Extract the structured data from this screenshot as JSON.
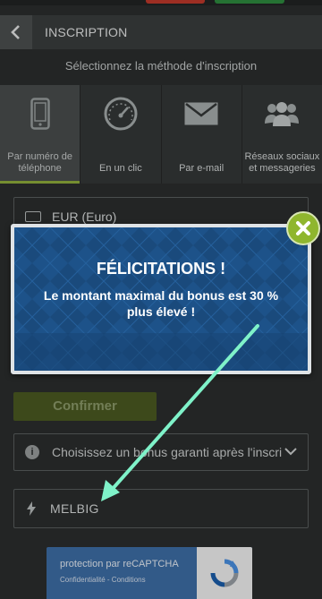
{
  "header": {
    "title": "INSCRIPTION",
    "back_icon": "chevron-left-icon"
  },
  "subtitle": "Sélectionnez la méthode d'inscription",
  "methods": [
    {
      "label": "Par numéro de téléphone",
      "icon": "phone-icon",
      "active": true
    },
    {
      "label": "En un clic",
      "icon": "speedometer-icon",
      "active": false
    },
    {
      "label": "Par e-mail",
      "icon": "envelope-icon",
      "active": false
    },
    {
      "label": "Réseaux sociaux et messageries",
      "icon": "users-icon",
      "active": false
    }
  ],
  "currency": {
    "value": "EUR (Euro)",
    "icon": "banknote-icon"
  },
  "confirm_label": "Confirmer",
  "bonus": {
    "placeholder": "Choisissez un bonus garanti après l'inscription",
    "icon": "info-icon"
  },
  "promo": {
    "value": "MELBIG",
    "icon": "lightning-icon"
  },
  "recaptcha": {
    "title": "protection par reCAPTCHA",
    "links": "Confidentialité - Conditions"
  },
  "modal": {
    "title": "FÉLICITATIONS !",
    "body": "Le montant maximal du bonus est 30 % plus élevé !",
    "close_icon": "close-icon"
  },
  "colors": {
    "accent": "#8fae3b",
    "modal_blue": "#1c4e82",
    "arrow": "#7ff2c9",
    "recaptcha_blue": "#3e6ea7"
  }
}
